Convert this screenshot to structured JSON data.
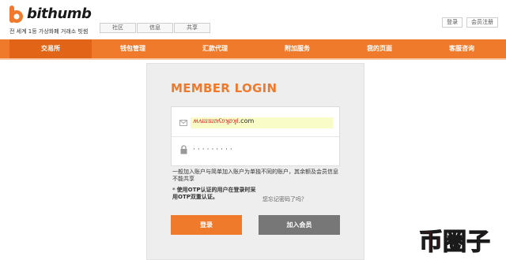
{
  "brand": {
    "name": "bithumb",
    "slogan": "전 세계 1등 가상화폐 거래소 빗썸",
    "accent_color": "#f07a2c"
  },
  "top_tabs": [
    "社区",
    "信息",
    "共享"
  ],
  "util_buttons": [
    "登录",
    "会员注册"
  ],
  "nav": {
    "items": [
      "交易所",
      "钱包管理",
      "汇款代理",
      "附加服务",
      "我的页面",
      "客服咨询"
    ],
    "active_index": 0
  },
  "login": {
    "title": "MEMBER LOGIN",
    "email_suffix": ".com",
    "password_mask": "·········",
    "note1": "一般加入账户与简单加入账户为单独不同的账户，其余额及会员信息不能共享",
    "note2_star": "*",
    "note2": "使用OTP认证的用户在登录时采用OTP双重认证。",
    "forgot_link": "您忘记密码了吗？",
    "login_button": "登录",
    "join_button": "加入会员"
  },
  "watermark_text": "币圈子",
  "icons": {
    "mail": "mail-icon",
    "lock": "lock-icon",
    "logo": "bithumb-logo-icon"
  }
}
